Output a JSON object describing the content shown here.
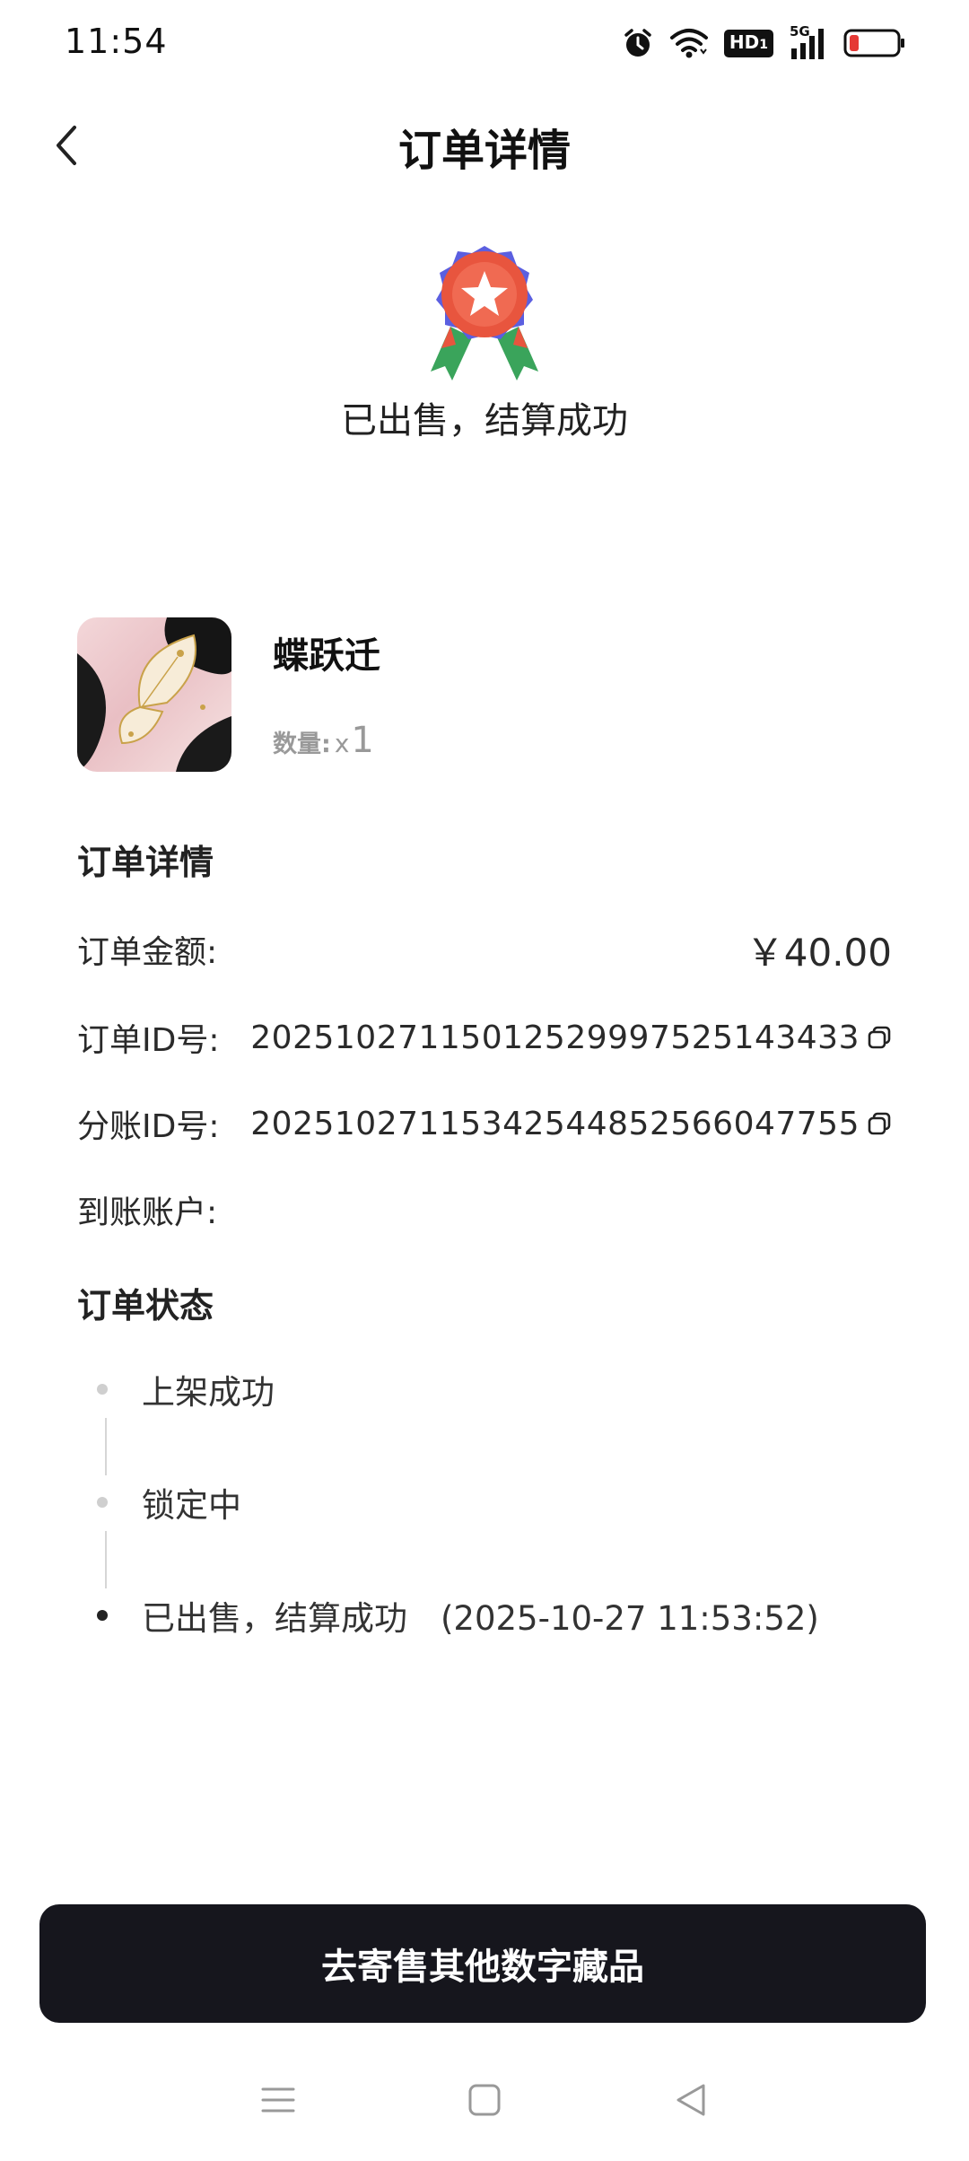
{
  "status_bar": {
    "time": "11:54",
    "hd_label": "HD",
    "network_label": "5G"
  },
  "header": {
    "title": "订单详情"
  },
  "status": {
    "title": "已出售，结算成功"
  },
  "product": {
    "name": "蝶跃迁",
    "quantity_label": "数量:",
    "quantity_prefix": "x",
    "quantity": "1"
  },
  "details": {
    "section_title": "订单详情",
    "amount_label": "订单金额:",
    "amount_value": "￥40.00",
    "order_id_label": "订单ID号:",
    "order_id_value": "20251027115012529997525143433",
    "split_id_label": "分账ID号:",
    "split_id_value": "20251027115342544852566047755",
    "account_label": "到账账户:",
    "account_value": ""
  },
  "order_status": {
    "section_title": "订单状态",
    "steps": [
      {
        "label": "上架成功"
      },
      {
        "label": "锁定中"
      },
      {
        "label": "已出售，结算成功　(2025-10-27 11:53:52)"
      }
    ]
  },
  "cta": {
    "label": "去寄售其他数字藏品"
  },
  "colors": {
    "cta_background": "#16161d",
    "badge_primary": "#e8553e",
    "badge_petal": "#5b5fe0",
    "battery_low": "#e53935"
  }
}
